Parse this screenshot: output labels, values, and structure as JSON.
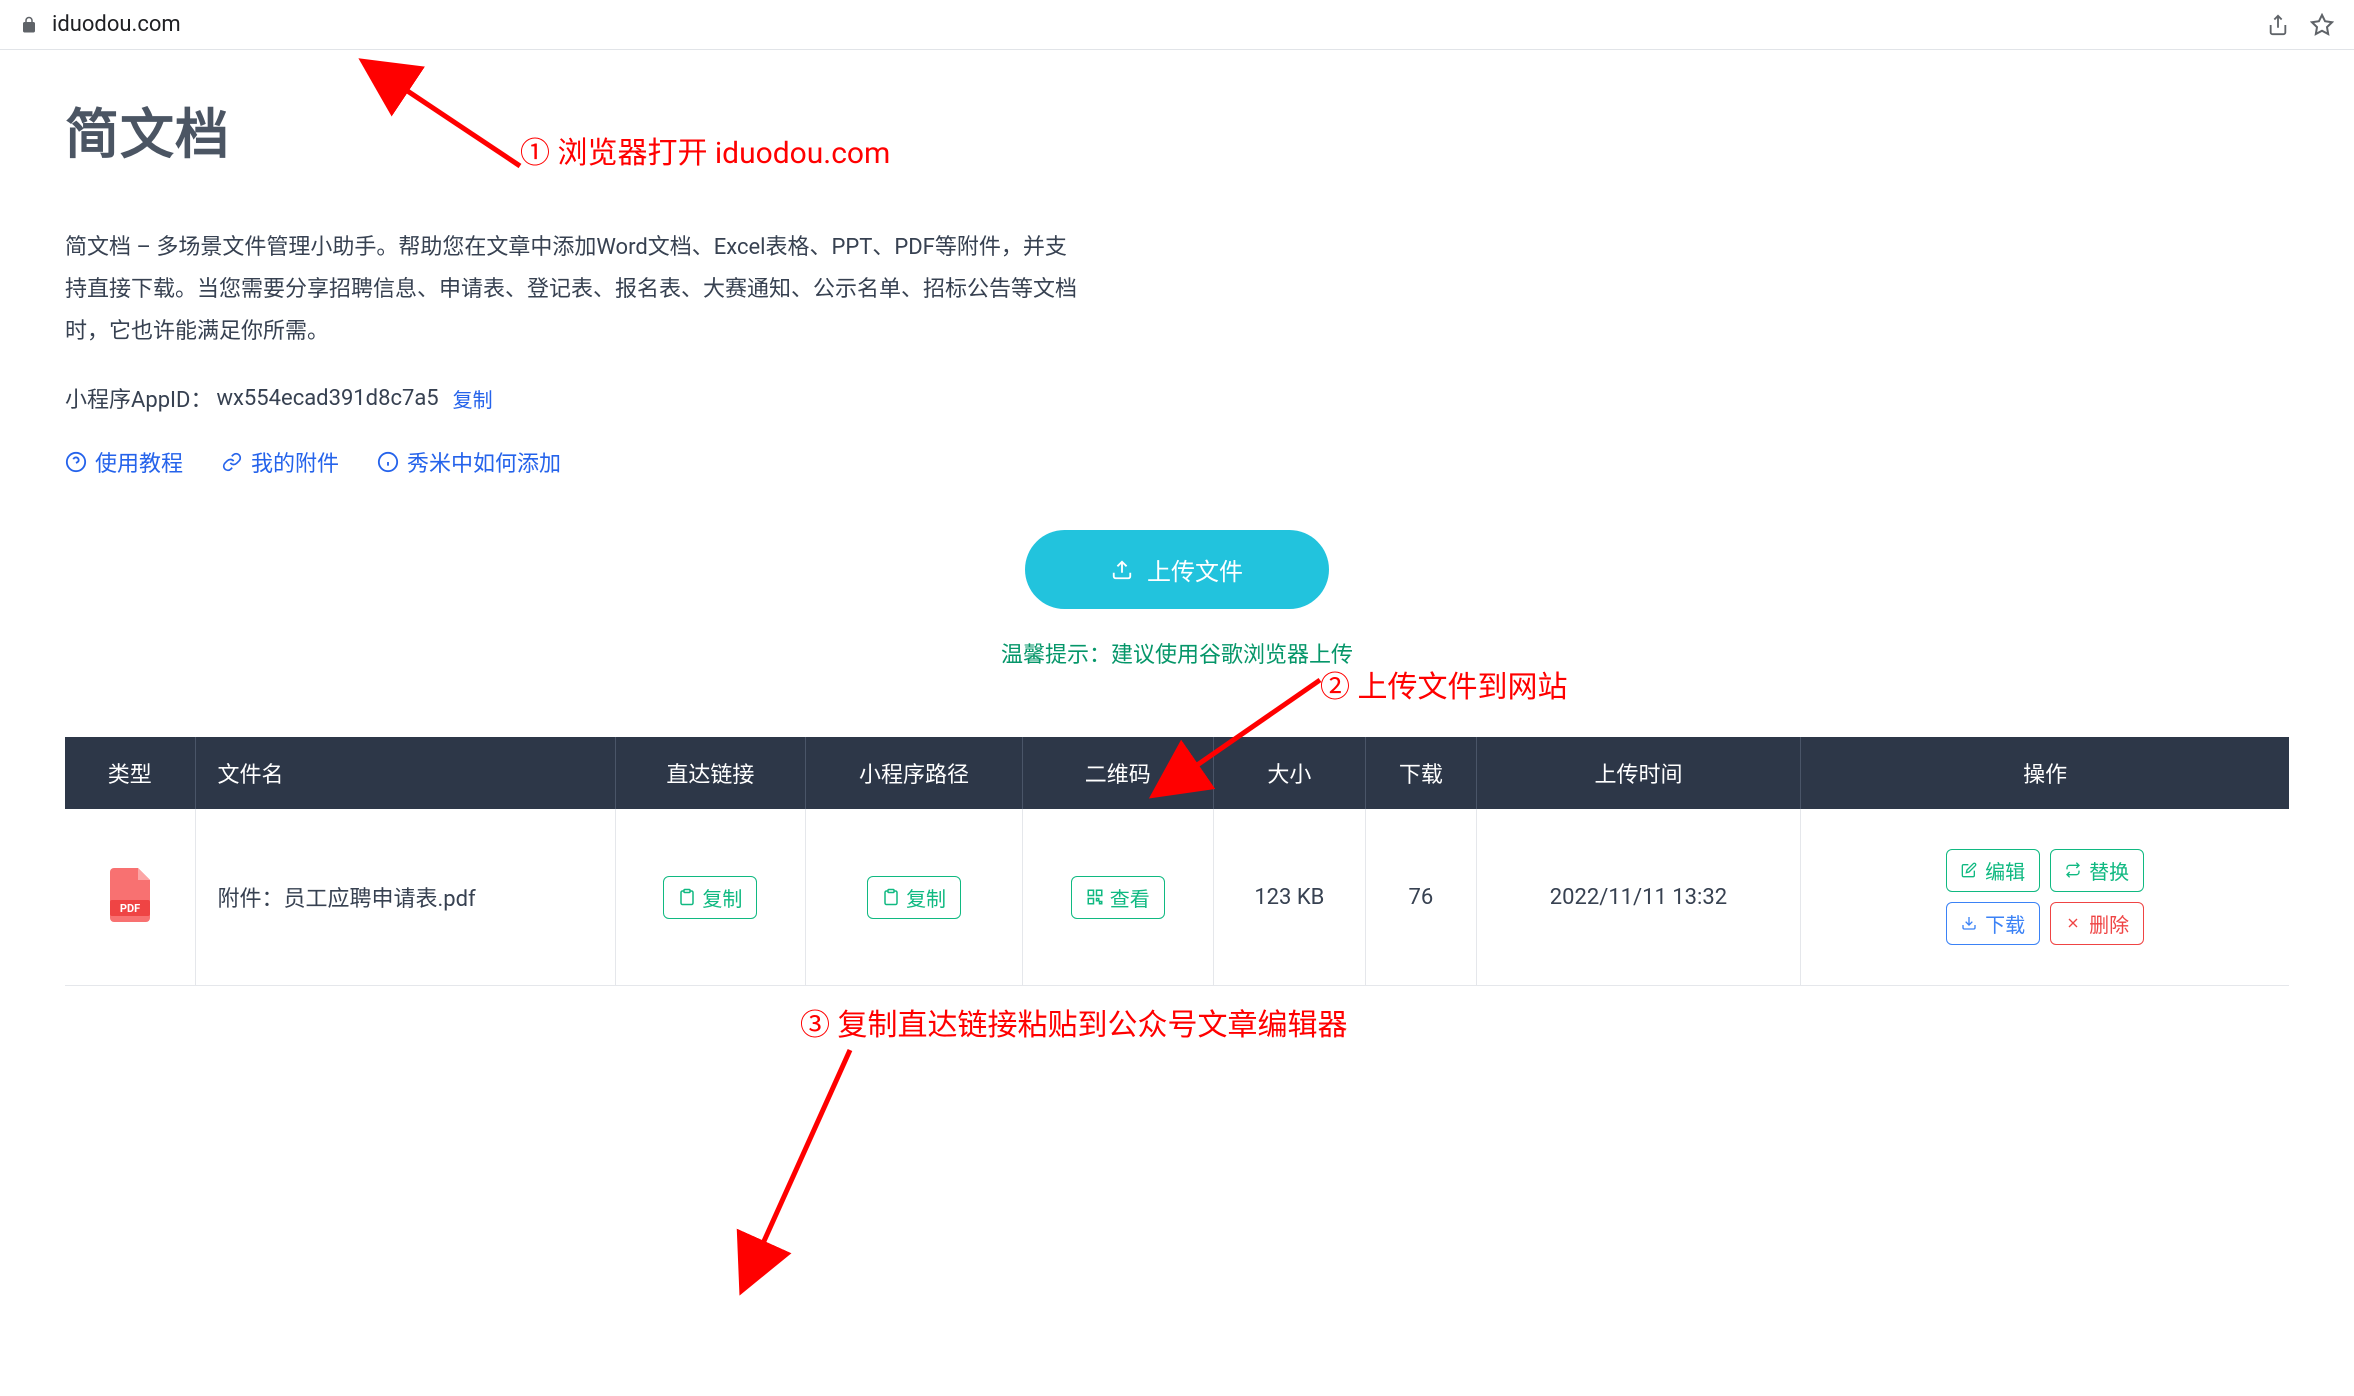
{
  "browser": {
    "url": "iduodou.com"
  },
  "page": {
    "title": "简文档",
    "description": "简文档 – 多场景文件管理小助手。帮助您在文章中添加Word文档、Excel表格、PPT、PDF等附件，并支持直接下载。当您需要分享招聘信息、申请表、登记表、报名表、大赛通知、公示名单、招标公告等文档时，它也许能满足你所需。",
    "appid_label": "小程序AppID：",
    "appid_value": "wx554ecad391d8c7a5",
    "copy_label": "复制"
  },
  "help_links": {
    "tutorial": "使用教程",
    "my_files": "我的附件",
    "xiumi": "秀米中如何添加"
  },
  "upload": {
    "button_label": "上传文件",
    "tip": "温馨提示：建议使用谷歌浏览器上传"
  },
  "annotations": {
    "step1": "① 浏览器打开   iduodou.com",
    "step2": "② 上传文件到网站",
    "step3": "③ 复制直达链接粘贴到公众号文章编辑器"
  },
  "table": {
    "headers": {
      "type": "类型",
      "filename": "文件名",
      "direct_link": "直达链接",
      "miniprogram_path": "小程序路径",
      "qrcode": "二维码",
      "size": "大小",
      "downloads": "下载",
      "upload_time": "上传时间",
      "actions": "操作"
    },
    "row": {
      "filename": "附件：员工应聘申请表.pdf",
      "copy_label": "复制",
      "view_label": "查看",
      "size": "123 KB",
      "downloads": "76",
      "upload_time": "2022/11/11 13:32",
      "edit_label": "编辑",
      "replace_label": "替换",
      "download_label": "下载",
      "delete_label": "删除"
    }
  }
}
